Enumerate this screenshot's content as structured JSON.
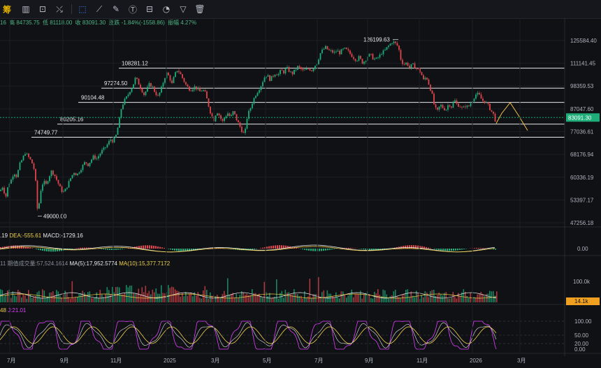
{
  "toolbar": {
    "logo": "筹",
    "icons": [
      "candle-settings-icon",
      "compare-icon",
      "indicator-icon",
      "cursor-icon",
      "ruler-icon",
      "draw-pen-icon",
      "text-icon",
      "shape-icon",
      "magnet-icon",
      "filter-icon",
      "delete-icon"
    ]
  },
  "ohlc": {
    "prefix": "16",
    "high": "高 84735.75",
    "low": "低 81118.00",
    "close": "收 83091.30",
    "change": "涨跌 -1.84%(-1558.86)",
    "amplitude": "振幅 4.27%"
  },
  "chart_data": {
    "type": "candlestick",
    "price_axis": {
      "ticks": [
        "125584.40",
        "111141.45",
        "98359.53",
        "87047.60",
        "77036.61",
        "68176.94",
        "60336.19",
        "53397.17",
        "47256.18"
      ],
      "current_price": "83091.30",
      "scale": "log"
    },
    "time_axis": {
      "labels": [
        "7月",
        "9月",
        "11月",
        "2025",
        "3月",
        "5月",
        "7月",
        "9月",
        "11月",
        "2026",
        "3月"
      ]
    },
    "horizontal_levels": [
      {
        "label": "108281.12",
        "value": 108281.12
      },
      {
        "label": "97274.50",
        "value": 97274.5
      },
      {
        "label": "90104.48",
        "value": 90104.48
      },
      {
        "label": "80205.16",
        "value": 80205.16
      },
      {
        "label": "74749.77",
        "value": 74749.77
      }
    ],
    "annotations": {
      "high_marker": "126199.63",
      "low_marker": "49000.00"
    },
    "price_path": [
      [
        0,
        56000
      ],
      [
        4,
        57500
      ],
      [
        8,
        54000
      ],
      [
        12,
        58000
      ],
      [
        16,
        59500
      ],
      [
        20,
        62000
      ],
      [
        24,
        60500
      ],
      [
        28,
        64500
      ],
      [
        32,
        66500
      ],
      [
        36,
        68800
      ],
      [
        40,
        67500
      ],
      [
        44,
        66000
      ],
      [
        48,
        64000
      ],
      [
        52,
        57000
      ],
      [
        54,
        49000
      ],
      [
        58,
        56000
      ],
      [
        62,
        59000
      ],
      [
        66,
        58000
      ],
      [
        70,
        60500
      ],
      [
        74,
        62500
      ],
      [
        78,
        61000
      ],
      [
        82,
        59000
      ],
      [
        86,
        57000
      ],
      [
        90,
        55500
      ],
      [
        94,
        56500
      ],
      [
        98,
        58500
      ],
      [
        102,
        60500
      ],
      [
        106,
        62000
      ],
      [
        110,
        61000
      ],
      [
        114,
        62500
      ],
      [
        118,
        64000
      ],
      [
        122,
        65500
      ],
      [
        126,
        64500
      ],
      [
        130,
        66000
      ],
      [
        134,
        67500
      ],
      [
        138,
        66500
      ],
      [
        142,
        68000
      ],
      [
        146,
        69500
      ],
      [
        150,
        70500
      ],
      [
        154,
        72000
      ],
      [
        158,
        74000
      ],
      [
        162,
        73000
      ],
      [
        166,
        75500
      ],
      [
        170,
        80500
      ],
      [
        174,
        88000
      ],
      [
        178,
        91000
      ],
      [
        182,
        93000
      ],
      [
        186,
        96000
      ],
      [
        190,
        98500
      ],
      [
        194,
        103000
      ],
      [
        198,
        100000
      ],
      [
        202,
        97000
      ],
      [
        206,
        94000
      ],
      [
        210,
        96500
      ],
      [
        214,
        99500
      ],
      [
        218,
        98000
      ],
      [
        222,
        95000
      ],
      [
        226,
        93000
      ],
      [
        230,
        96000
      ],
      [
        234,
        101000
      ],
      [
        238,
        105500
      ],
      [
        242,
        103500
      ],
      [
        246,
        99500
      ],
      [
        250,
        104500
      ],
      [
        254,
        107500
      ],
      [
        258,
        105000
      ],
      [
        262,
        102000
      ],
      [
        266,
        99000
      ],
      [
        270,
        97000
      ],
      [
        274,
        96500
      ],
      [
        278,
        98000
      ],
      [
        282,
        97000
      ],
      [
        286,
        95500
      ],
      [
        290,
        96500
      ],
      [
        294,
        94500
      ],
      [
        298,
        89000
      ],
      [
        302,
        84500
      ],
      [
        306,
        82000
      ],
      [
        310,
        86000
      ],
      [
        314,
        84000
      ],
      [
        318,
        81000
      ],
      [
        322,
        83500
      ],
      [
        326,
        85000
      ],
      [
        330,
        83000
      ],
      [
        334,
        86000
      ],
      [
        338,
        82500
      ],
      [
        342,
        80000
      ],
      [
        346,
        77500
      ],
      [
        350,
        75500
      ],
      [
        354,
        84000
      ],
      [
        358,
        87000
      ],
      [
        362,
        91000
      ],
      [
        366,
        94000
      ],
      [
        370,
        96500
      ],
      [
        374,
        99000
      ],
      [
        378,
        103000
      ],
      [
        382,
        104500
      ],
      [
        386,
        102000
      ],
      [
        390,
        103500
      ],
      [
        394,
        105500
      ],
      [
        398,
        104500
      ],
      [
        402,
        107000
      ],
      [
        406,
        106000
      ],
      [
        410,
        108500
      ],
      [
        414,
        106500
      ],
      [
        418,
        105000
      ],
      [
        422,
        107000
      ],
      [
        426,
        109000
      ],
      [
        430,
        108000
      ],
      [
        434,
        106500
      ],
      [
        438,
        107500
      ],
      [
        442,
        108000
      ],
      [
        446,
        107000
      ],
      [
        450,
        109500
      ],
      [
        454,
        111500
      ],
      [
        458,
        117000
      ],
      [
        462,
        119500
      ],
      [
        466,
        121000
      ],
      [
        470,
        119000
      ],
      [
        474,
        118500
      ],
      [
        478,
        117500
      ],
      [
        482,
        119000
      ],
      [
        486,
        117500
      ],
      [
        490,
        119500
      ],
      [
        494,
        120000
      ],
      [
        498,
        118500
      ],
      [
        502,
        116500
      ],
      [
        506,
        114500
      ],
      [
        510,
        113000
      ],
      [
        514,
        115000
      ],
      [
        518,
        111500
      ],
      [
        522,
        112500
      ],
      [
        526,
        115500
      ],
      [
        530,
        116500
      ],
      [
        534,
        114000
      ],
      [
        538,
        113500
      ],
      [
        542,
        115000
      ],
      [
        546,
        117500
      ],
      [
        550,
        118500
      ],
      [
        554,
        121000
      ],
      [
        558,
        123000
      ],
      [
        562,
        125000
      ],
      [
        566,
        123500
      ],
      [
        570,
        121500
      ],
      [
        574,
        112500
      ],
      [
        578,
        110500
      ],
      [
        582,
        111500
      ],
      [
        586,
        108500
      ],
      [
        590,
        110500
      ],
      [
        594,
        109000
      ],
      [
        598,
        107500
      ],
      [
        602,
        106000
      ],
      [
        606,
        101500
      ],
      [
        610,
        103500
      ],
      [
        614,
        99000
      ],
      [
        618,
        94500
      ],
      [
        622,
        87500
      ],
      [
        626,
        86000
      ],
      [
        630,
        89000
      ],
      [
        634,
        87500
      ],
      [
        638,
        86500
      ],
      [
        642,
        89500
      ],
      [
        646,
        88000
      ],
      [
        650,
        91500
      ],
      [
        654,
        89000
      ],
      [
        658,
        88500
      ],
      [
        662,
        87000
      ],
      [
        666,
        88500
      ],
      [
        670,
        87800
      ],
      [
        674,
        90000
      ],
      [
        678,
        92500
      ],
      [
        682,
        94500
      ],
      [
        686,
        93500
      ],
      [
        690,
        91000
      ],
      [
        694,
        90500
      ],
      [
        698,
        89000
      ],
      [
        702,
        86500
      ],
      [
        706,
        84500
      ],
      [
        710,
        80500
      ]
    ],
    "projection": [
      [
        710,
        80500
      ],
      [
        718,
        85000
      ],
      [
        730,
        90000
      ],
      [
        742,
        84000
      ],
      [
        755,
        77500
      ]
    ],
    "macd": {
      "label_value": ".19",
      "dea_label": "DEA:-555.61",
      "macd_label": "MACD:-1729.16",
      "axis_tick": "0.00"
    },
    "volume": {
      "label_prefix": "11",
      "amount_label": "期值成交量:57,524.1614",
      "ma5_label": "MA(5):17,952.5774",
      "ma10_label": "MA(10):15,377.7172",
      "axis_tick": "100.0k",
      "current_value": "14.1k"
    },
    "kdj": {
      "label_prefix": "48",
      "j_label": "J:21.01",
      "axis_ticks": [
        "100.00",
        "50.00",
        "20.00",
        "0.00"
      ]
    }
  },
  "colors": {
    "up": "#1fae7a",
    "down": "#e0464b",
    "level_line": "#e8e8e8",
    "current_price_bg": "#1fae7a",
    "projection": "#f2c14e",
    "dea": "#f2d24b",
    "macd_line": "#e9e9e9",
    "kdj_k": "#f2d24b",
    "kdj_d": "#e040fb",
    "volume_badge": "#f0a020"
  }
}
